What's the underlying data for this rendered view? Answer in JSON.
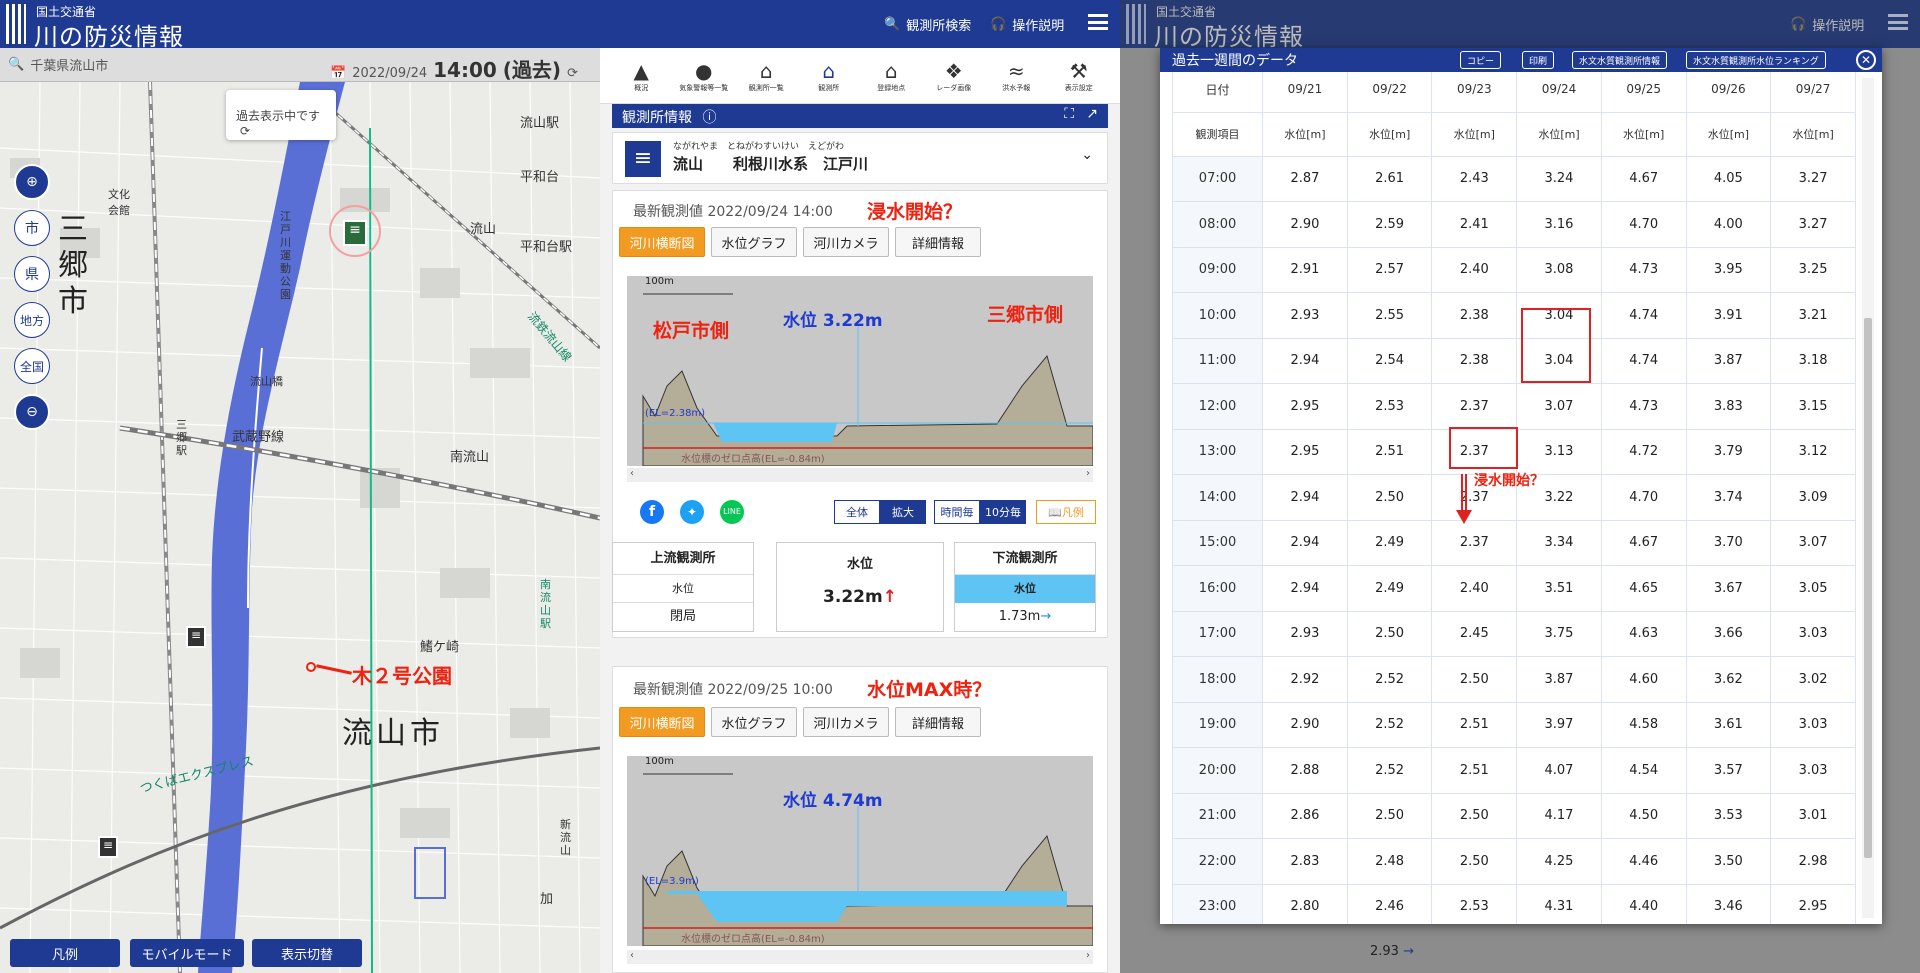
{
  "header": {
    "ministry": "国土交通省",
    "app_title": "川の防災情報",
    "search_link": "観測所検索",
    "help_link": "操作説明"
  },
  "map": {
    "location": "千葉県流山市",
    "date": "2022/09/24",
    "time": "14:00",
    "time_mode": "(過去)",
    "past_notice": "過去表示中です",
    "zoom_labels": [
      "市",
      "県",
      "地方",
      "全国"
    ],
    "city_left": "三郷市",
    "city_main": "流山市",
    "park_label": "木２号公園",
    "labels": [
      "流山駅",
      "平和台",
      "平和台駅",
      "文化会館",
      "江戸川運動公園",
      "武蔵野線",
      "流山橋",
      "三郷駅",
      "南流山",
      "南流山駅",
      "流鉄流山線",
      "つくばエクスプレス",
      "流山",
      "加",
      "新流山",
      "鰭ケ崎"
    ],
    "buttons": [
      "凡例",
      "モバイルモード",
      "表示切替"
    ]
  },
  "toolbar": {
    "items": [
      "概況",
      "気象警報等一覧",
      "観測所一覧",
      "観測所",
      "登録地点",
      "レーダ画像",
      "洪水予報",
      "表示設定"
    ]
  },
  "station": {
    "section_title": "観測所情報",
    "ruby": "ながれやま　とねがわすいけい　えどがわ",
    "name": "流山　　利根川水系　江戸川"
  },
  "obs1": {
    "label": "最新観測値 2022/09/24 14:00",
    "annotation": "浸水開始？",
    "tabs": [
      "河川横断図",
      "水位グラフ",
      "河川カメラ",
      "詳細情報"
    ],
    "scale": "100m",
    "level_text": "水位 3.22m",
    "left_bank": "松戸市側",
    "right_bank": "三郷市側",
    "el_label": "(EL=2.38m)",
    "zero_label": "水位標のゼロ点高(EL=-0.84m)",
    "view_all": "全体",
    "view_zoom": "拡大",
    "interval_hour": "時間毎",
    "interval_10min": "10分毎",
    "legend": "凡例",
    "upstream_title": "上流観測所",
    "upstream_sub": "水位",
    "upstream_value": "閉局",
    "center_title": "水位",
    "center_value": "3.22m",
    "downstream_title": "下流観測所",
    "downstream_sub": "水位",
    "downstream_value": "1.73m"
  },
  "obs2": {
    "label": "最新観測値 2022/09/25 10:00",
    "annotation": "水位MAX時？",
    "tabs": [
      "河川横断図",
      "水位グラフ",
      "河川カメラ",
      "詳細情報"
    ],
    "scale": "100m",
    "level_text": "水位 4.74m",
    "el_label": "(EL=3.9m)",
    "zero_label": "水位標のゼロ点高(EL=-0.84m)"
  },
  "right_header": {
    "ministry": "国土交通省",
    "app_title": "川の防災情報",
    "help_link": "操作説明"
  },
  "modal": {
    "title": "過去一週間のデータ",
    "buttons": [
      "コピー",
      "印刷",
      "水文水質観測所情報",
      "水文水質観測所水位ランキング"
    ],
    "col_date": "日付",
    "col_item": "観測項目",
    "dates": [
      "09/21",
      "09/22",
      "09/23",
      "09/24",
      "09/25",
      "09/26",
      "09/27"
    ],
    "unit": "水位[m]",
    "annotation": "浸水開始？",
    "bottom_value": "2.93",
    "rows": [
      {
        "hour": "07:00",
        "values": [
          "2.87",
          "2.61",
          "2.43",
          "3.24",
          "4.67",
          "4.05",
          "3.27"
        ]
      },
      {
        "hour": "08:00",
        "values": [
          "2.90",
          "2.59",
          "2.41",
          "3.16",
          "4.70",
          "4.00",
          "3.27"
        ]
      },
      {
        "hour": "09:00",
        "values": [
          "2.91",
          "2.57",
          "2.40",
          "3.08",
          "4.73",
          "3.95",
          "3.25"
        ]
      },
      {
        "hour": "10:00",
        "values": [
          "2.93",
          "2.55",
          "2.38",
          "3.04",
          "4.74",
          "3.91",
          "3.21"
        ]
      },
      {
        "hour": "11:00",
        "values": [
          "2.94",
          "2.54",
          "2.38",
          "3.04",
          "4.74",
          "3.87",
          "3.18"
        ]
      },
      {
        "hour": "12:00",
        "values": [
          "2.95",
          "2.53",
          "2.37",
          "3.07",
          "4.73",
          "3.83",
          "3.15"
        ]
      },
      {
        "hour": "13:00",
        "values": [
          "2.95",
          "2.51",
          "2.37",
          "3.13",
          "4.72",
          "3.79",
          "3.12"
        ]
      },
      {
        "hour": "14:00",
        "values": [
          "2.94",
          "2.50",
          "2.37",
          "3.22",
          "4.70",
          "3.74",
          "3.09"
        ]
      },
      {
        "hour": "15:00",
        "values": [
          "2.94",
          "2.49",
          "2.37",
          "3.34",
          "4.67",
          "3.70",
          "3.07"
        ]
      },
      {
        "hour": "16:00",
        "values": [
          "2.94",
          "2.49",
          "2.40",
          "3.51",
          "4.65",
          "3.67",
          "3.05"
        ]
      },
      {
        "hour": "17:00",
        "values": [
          "2.93",
          "2.50",
          "2.45",
          "3.75",
          "4.63",
          "3.66",
          "3.03"
        ]
      },
      {
        "hour": "18:00",
        "values": [
          "2.92",
          "2.52",
          "2.50",
          "3.87",
          "4.60",
          "3.62",
          "3.02"
        ]
      },
      {
        "hour": "19:00",
        "values": [
          "2.90",
          "2.52",
          "2.51",
          "3.97",
          "4.58",
          "3.61",
          "3.03"
        ]
      },
      {
        "hour": "20:00",
        "values": [
          "2.88",
          "2.52",
          "2.51",
          "4.07",
          "4.54",
          "3.57",
          "3.03"
        ]
      },
      {
        "hour": "21:00",
        "values": [
          "2.86",
          "2.50",
          "2.50",
          "4.17",
          "4.50",
          "3.53",
          "3.01"
        ]
      },
      {
        "hour": "22:00",
        "values": [
          "2.83",
          "2.48",
          "2.50",
          "4.25",
          "4.46",
          "3.50",
          "2.98"
        ]
      },
      {
        "hour": "23:00",
        "values": [
          "2.80",
          "2.46",
          "2.53",
          "4.31",
          "4.40",
          "3.46",
          "2.95"
        ]
      }
    ]
  },
  "colors": {
    "brand": "#1f3a93",
    "accent": "#f29b22",
    "annotation": "#e21111",
    "water": "#5ec4f3"
  }
}
